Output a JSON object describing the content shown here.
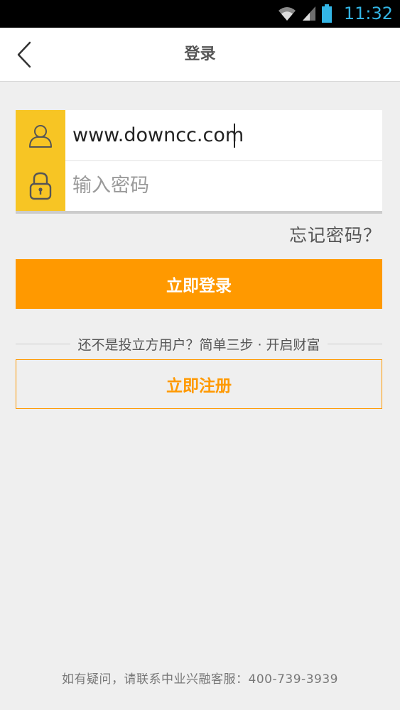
{
  "status_bar": {
    "time": "11:32",
    "icons": [
      "wifi-icon",
      "signal-icon",
      "battery-icon"
    ]
  },
  "header": {
    "title": "登录",
    "back_icon": "chevron-left-icon"
  },
  "login_form": {
    "username": {
      "value": "www.downcc.com",
      "icon": "user-icon"
    },
    "password": {
      "value": "",
      "placeholder": "输入密码",
      "icon": "lock-icon"
    },
    "forgot_label": "忘记密码？",
    "login_label": "立即登录"
  },
  "register": {
    "prompt": "还不是投立方用户？简单三步 · 开启财富",
    "button_label": "立即注册"
  },
  "footer": {
    "contact_text": "如有疑问，请联系中业兴融客服：400-739-3939"
  },
  "colors": {
    "accent_orange": "#ff9900",
    "icon_yellow": "#f7c524",
    "status_blue": "#33b5e5",
    "background": "#efefef"
  }
}
